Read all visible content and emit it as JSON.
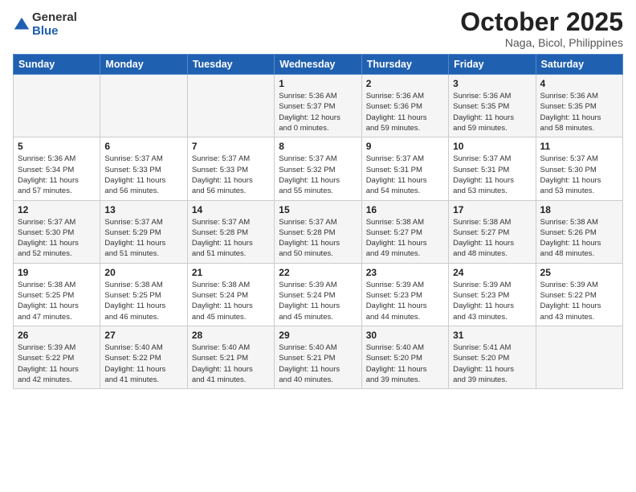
{
  "header": {
    "logo_general": "General",
    "logo_blue": "Blue",
    "month_title": "October 2025",
    "location": "Naga, Bicol, Philippines"
  },
  "calendar": {
    "days_of_week": [
      "Sunday",
      "Monday",
      "Tuesday",
      "Wednesday",
      "Thursday",
      "Friday",
      "Saturday"
    ],
    "weeks": [
      [
        {
          "day": "",
          "info": ""
        },
        {
          "day": "",
          "info": ""
        },
        {
          "day": "",
          "info": ""
        },
        {
          "day": "1",
          "info": "Sunrise: 5:36 AM\nSunset: 5:37 PM\nDaylight: 12 hours\nand 0 minutes."
        },
        {
          "day": "2",
          "info": "Sunrise: 5:36 AM\nSunset: 5:36 PM\nDaylight: 11 hours\nand 59 minutes."
        },
        {
          "day": "3",
          "info": "Sunrise: 5:36 AM\nSunset: 5:35 PM\nDaylight: 11 hours\nand 59 minutes."
        },
        {
          "day": "4",
          "info": "Sunrise: 5:36 AM\nSunset: 5:35 PM\nDaylight: 11 hours\nand 58 minutes."
        }
      ],
      [
        {
          "day": "5",
          "info": "Sunrise: 5:36 AM\nSunset: 5:34 PM\nDaylight: 11 hours\nand 57 minutes."
        },
        {
          "day": "6",
          "info": "Sunrise: 5:37 AM\nSunset: 5:33 PM\nDaylight: 11 hours\nand 56 minutes."
        },
        {
          "day": "7",
          "info": "Sunrise: 5:37 AM\nSunset: 5:33 PM\nDaylight: 11 hours\nand 56 minutes."
        },
        {
          "day": "8",
          "info": "Sunrise: 5:37 AM\nSunset: 5:32 PM\nDaylight: 11 hours\nand 55 minutes."
        },
        {
          "day": "9",
          "info": "Sunrise: 5:37 AM\nSunset: 5:31 PM\nDaylight: 11 hours\nand 54 minutes."
        },
        {
          "day": "10",
          "info": "Sunrise: 5:37 AM\nSunset: 5:31 PM\nDaylight: 11 hours\nand 53 minutes."
        },
        {
          "day": "11",
          "info": "Sunrise: 5:37 AM\nSunset: 5:30 PM\nDaylight: 11 hours\nand 53 minutes."
        }
      ],
      [
        {
          "day": "12",
          "info": "Sunrise: 5:37 AM\nSunset: 5:30 PM\nDaylight: 11 hours\nand 52 minutes."
        },
        {
          "day": "13",
          "info": "Sunrise: 5:37 AM\nSunset: 5:29 PM\nDaylight: 11 hours\nand 51 minutes."
        },
        {
          "day": "14",
          "info": "Sunrise: 5:37 AM\nSunset: 5:28 PM\nDaylight: 11 hours\nand 51 minutes."
        },
        {
          "day": "15",
          "info": "Sunrise: 5:37 AM\nSunset: 5:28 PM\nDaylight: 11 hours\nand 50 minutes."
        },
        {
          "day": "16",
          "info": "Sunrise: 5:38 AM\nSunset: 5:27 PM\nDaylight: 11 hours\nand 49 minutes."
        },
        {
          "day": "17",
          "info": "Sunrise: 5:38 AM\nSunset: 5:27 PM\nDaylight: 11 hours\nand 48 minutes."
        },
        {
          "day": "18",
          "info": "Sunrise: 5:38 AM\nSunset: 5:26 PM\nDaylight: 11 hours\nand 48 minutes."
        }
      ],
      [
        {
          "day": "19",
          "info": "Sunrise: 5:38 AM\nSunset: 5:25 PM\nDaylight: 11 hours\nand 47 minutes."
        },
        {
          "day": "20",
          "info": "Sunrise: 5:38 AM\nSunset: 5:25 PM\nDaylight: 11 hours\nand 46 minutes."
        },
        {
          "day": "21",
          "info": "Sunrise: 5:38 AM\nSunset: 5:24 PM\nDaylight: 11 hours\nand 45 minutes."
        },
        {
          "day": "22",
          "info": "Sunrise: 5:39 AM\nSunset: 5:24 PM\nDaylight: 11 hours\nand 45 minutes."
        },
        {
          "day": "23",
          "info": "Sunrise: 5:39 AM\nSunset: 5:23 PM\nDaylight: 11 hours\nand 44 minutes."
        },
        {
          "day": "24",
          "info": "Sunrise: 5:39 AM\nSunset: 5:23 PM\nDaylight: 11 hours\nand 43 minutes."
        },
        {
          "day": "25",
          "info": "Sunrise: 5:39 AM\nSunset: 5:22 PM\nDaylight: 11 hours\nand 43 minutes."
        }
      ],
      [
        {
          "day": "26",
          "info": "Sunrise: 5:39 AM\nSunset: 5:22 PM\nDaylight: 11 hours\nand 42 minutes."
        },
        {
          "day": "27",
          "info": "Sunrise: 5:40 AM\nSunset: 5:22 PM\nDaylight: 11 hours\nand 41 minutes."
        },
        {
          "day": "28",
          "info": "Sunrise: 5:40 AM\nSunset: 5:21 PM\nDaylight: 11 hours\nand 41 minutes."
        },
        {
          "day": "29",
          "info": "Sunrise: 5:40 AM\nSunset: 5:21 PM\nDaylight: 11 hours\nand 40 minutes."
        },
        {
          "day": "30",
          "info": "Sunrise: 5:40 AM\nSunset: 5:20 PM\nDaylight: 11 hours\nand 39 minutes."
        },
        {
          "day": "31",
          "info": "Sunrise: 5:41 AM\nSunset: 5:20 PM\nDaylight: 11 hours\nand 39 minutes."
        },
        {
          "day": "",
          "info": ""
        }
      ]
    ]
  }
}
